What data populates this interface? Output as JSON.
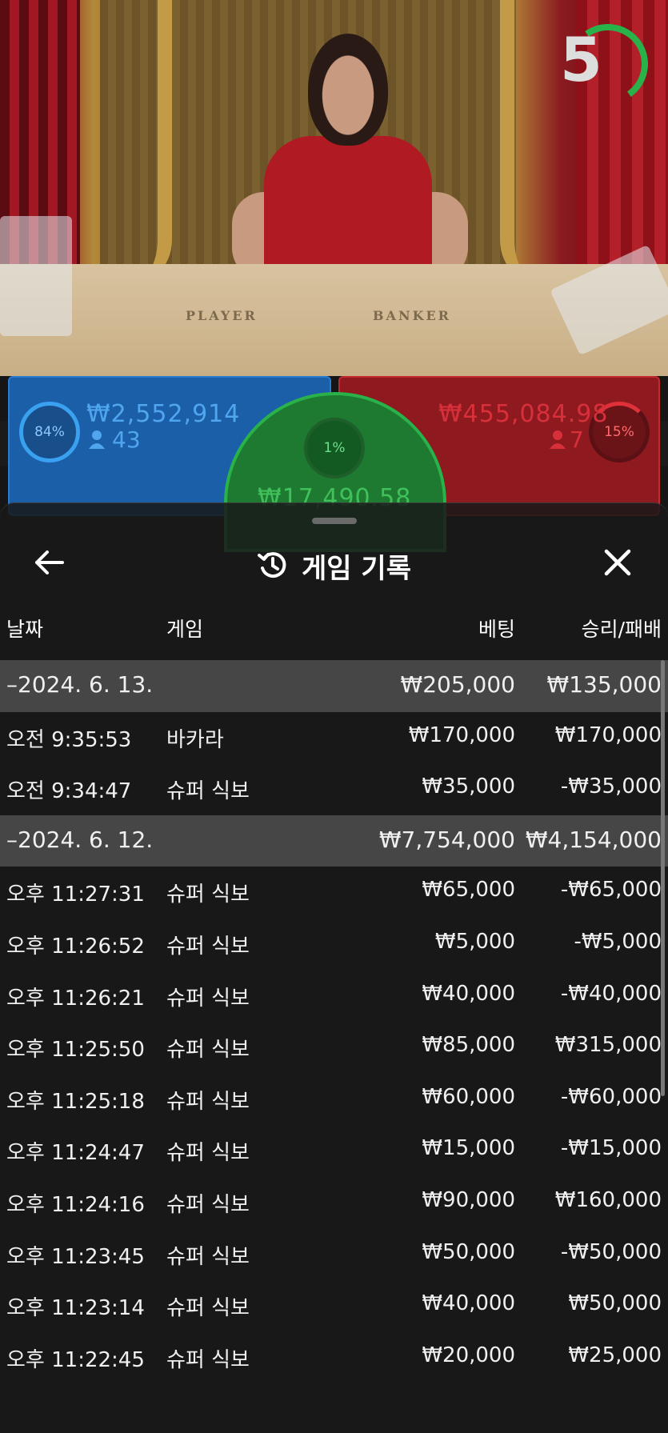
{
  "game_view": {
    "timer_value": "5",
    "table_label_player": "PLAYER",
    "table_label_banker": "BANKER",
    "player": {
      "percent": "84%",
      "amount": "₩2,552,914",
      "count": "43"
    },
    "banker": {
      "percent": "15%",
      "amount": "₩455,084.98",
      "count": "7"
    },
    "tie": {
      "percent": "1%",
      "amount": "₩17,490.58"
    }
  },
  "history": {
    "title": "게임 기록",
    "columns": {
      "date": "날짜",
      "game": "게임",
      "bet": "베팅",
      "result": "승리/패배"
    },
    "rows": [
      {
        "type": "group",
        "date": "–2024. 6. 13.",
        "game": "",
        "bet": "₩205,000",
        "result": "₩135,000"
      },
      {
        "type": "item",
        "date": "오전 9:35:53",
        "game": "바카라",
        "bet": "₩170,000",
        "result": "₩170,000"
      },
      {
        "type": "item",
        "date": "오전 9:34:47",
        "game": "슈퍼 식보",
        "bet": "₩35,000",
        "result": "-₩35,000"
      },
      {
        "type": "group",
        "date": "–2024. 6. 12.",
        "game": "",
        "bet": "₩7,754,000",
        "result": "₩4,154,000"
      },
      {
        "type": "item",
        "date": "오후 11:27:31",
        "game": "슈퍼 식보",
        "bet": "₩65,000",
        "result": "-₩65,000"
      },
      {
        "type": "item",
        "date": "오후 11:26:52",
        "game": "슈퍼 식보",
        "bet": "₩5,000",
        "result": "-₩5,000"
      },
      {
        "type": "item",
        "date": "오후 11:26:21",
        "game": "슈퍼 식보",
        "bet": "₩40,000",
        "result": "-₩40,000"
      },
      {
        "type": "item",
        "date": "오후 11:25:50",
        "game": "슈퍼 식보",
        "bet": "₩85,000",
        "result": "₩315,000"
      },
      {
        "type": "item",
        "date": "오후 11:25:18",
        "game": "슈퍼 식보",
        "bet": "₩60,000",
        "result": "-₩60,000"
      },
      {
        "type": "item",
        "date": "오후 11:24:47",
        "game": "슈퍼 식보",
        "bet": "₩15,000",
        "result": "-₩15,000"
      },
      {
        "type": "item",
        "date": "오후 11:24:16",
        "game": "슈퍼 식보",
        "bet": "₩90,000",
        "result": "₩160,000"
      },
      {
        "type": "item",
        "date": "오후 11:23:45",
        "game": "슈퍼 식보",
        "bet": "₩50,000",
        "result": "-₩50,000"
      },
      {
        "type": "item",
        "date": "오후 11:23:14",
        "game": "슈퍼 식보",
        "bet": "₩40,000",
        "result": "₩50,000"
      },
      {
        "type": "item",
        "date": "오후 11:22:45",
        "game": "슈퍼 식보",
        "bet": "₩20,000",
        "result": "₩25,000"
      }
    ]
  },
  "colors": {
    "panel_bg": "#181818",
    "group_row_bg": "#6e6e6e",
    "player_blue": "#1a5fa8",
    "banker_red": "#8e1a20",
    "tie_green": "#1d7a30",
    "timer_green": "#2ab24a"
  },
  "icons": {
    "back": "arrow-left-icon",
    "history": "history-clock-icon",
    "close": "close-icon",
    "person": "person-icon"
  }
}
